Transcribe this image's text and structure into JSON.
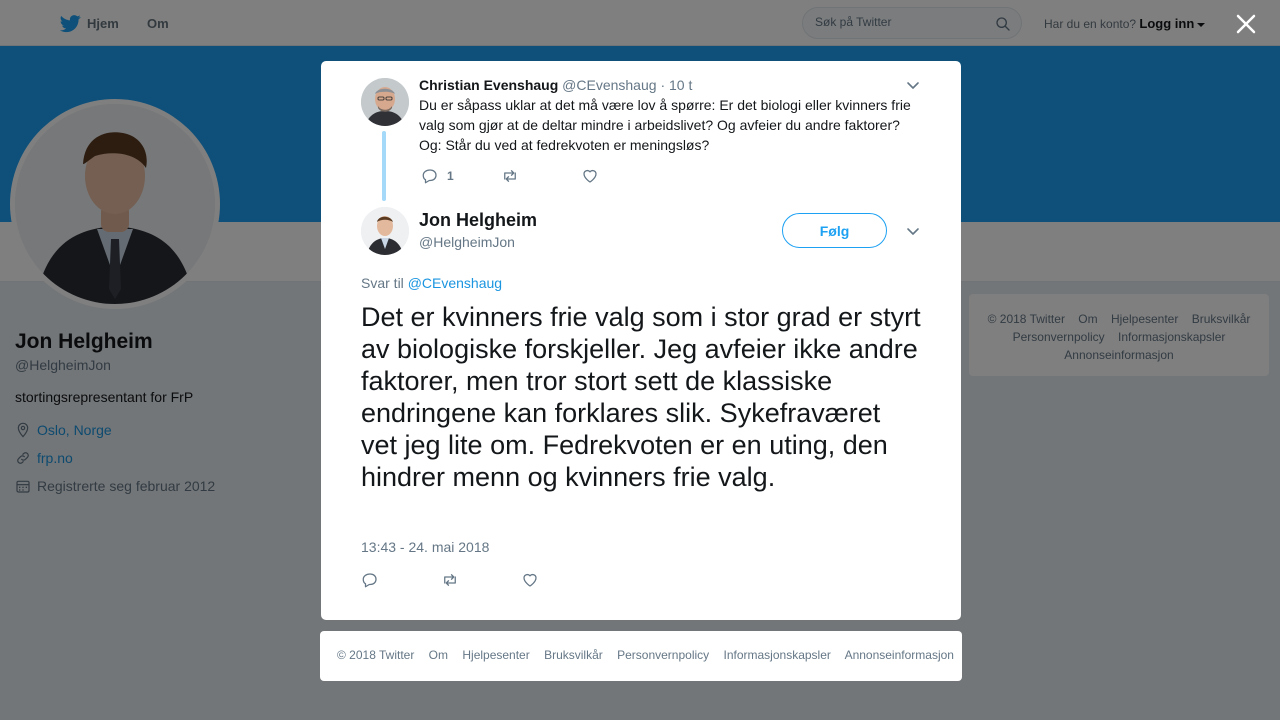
{
  "nav": {
    "home_label": "Hjem",
    "about_label": "Om",
    "search_placeholder": "Søk på Twitter",
    "account_question": "Har du en konto?",
    "login_label": "Logg inn"
  },
  "profile": {
    "name": "Jon Helgheim",
    "handle": "@HelgheimJon",
    "bio": "stortingsrepresentant for FrP",
    "location": "Oslo, Norge",
    "website": "frp.no",
    "joined": "Registrerte seg februar 2012"
  },
  "side_footer": {
    "items": [
      "© 2018 Twitter",
      "Om",
      "Hjelpesenter",
      "Bruksvilkår",
      "Personvernpolicy",
      "Informasjonskapsler",
      "Annonseinformasjon"
    ]
  },
  "parent_tweet": {
    "name": "Christian Evenshaug",
    "handle": "@CEvenshaug",
    "time": "· 10 t",
    "text": "Du er såpass uklar at det må være lov å spørre: Er det biologi eller kvinners frie valg som gjør at de deltar mindre i arbeidslivet? Og avfeier du andre faktorer? Og: Står du ved at fedrekvoten er meningsløs?",
    "reply_count": "1"
  },
  "main_tweet": {
    "name": "Jon Helgheim",
    "handle": "@HelgheimJon",
    "follow_label": "Følg",
    "reply_prefix": "Svar til",
    "reply_to": "@CEvenshaug",
    "text": "Det er kvinners frie valg som i stor grad er styrt av biologiske forskjeller. Jeg avfeier ikke andre faktorer, men tror stort sett de klassiske endringene kan forklares slik. Sykefraværet vet jeg lite om. Fedrekvoten er en uting, den hindrer menn og kvinners frie valg.",
    "timestamp": "13:43 - 24. mai 2018"
  },
  "modal_footer": {
    "items": [
      "© 2018 Twitter",
      "Om",
      "Hjelpesenter",
      "Bruksvilkår",
      "Personvernpolicy",
      "Informasjonskapsler",
      "Annonseinformasjon"
    ]
  },
  "colors": {
    "accent": "#1da1f2",
    "link": "#1b95e0",
    "muted": "#657786",
    "thread_line": "#a4d9f9"
  }
}
